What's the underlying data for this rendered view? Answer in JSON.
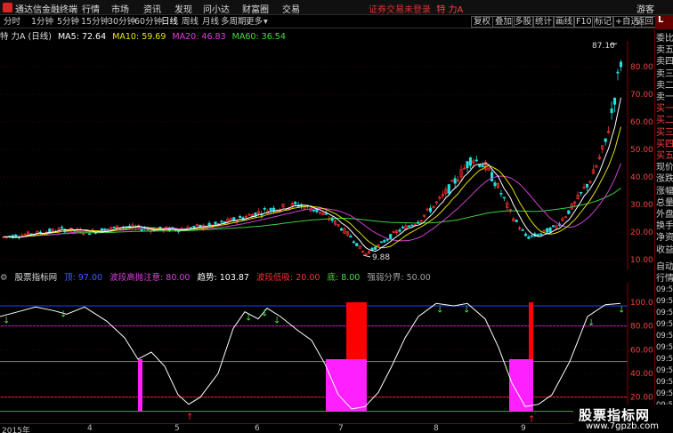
{
  "app": {
    "title": "通达信金融终端",
    "menu": [
      "行情",
      "市场",
      "资讯",
      "发现",
      "问小达",
      "财富圈",
      "交易"
    ],
    "warning": "证券交易未登录",
    "stock_name": "特 力A",
    "guest": "游客",
    "window_buttons": [
      "□",
      "⊟",
      "✕"
    ]
  },
  "toolbar": {
    "periods": [
      "分时",
      "1分钟",
      "5分钟",
      "15分钟",
      "30分钟",
      "60分钟",
      "日线",
      "周线",
      "月线",
      "多周期",
      "更多"
    ],
    "active_period": "日线",
    "right_buttons": [
      "复权",
      "叠加",
      "多股",
      "统计",
      "画线",
      "F10",
      "标记",
      "+自选",
      "返回"
    ]
  },
  "main_chart": {
    "title": "特 力A (日线)",
    "ma": [
      {
        "label": "MA5: 72.64",
        "color": "#ffffff"
      },
      {
        "label": "MA10: 59.69",
        "color": "#e8e800"
      },
      {
        "label": "MA20: 46.83",
        "color": "#e040e0"
      },
      {
        "label": "MA60: 36.54",
        "color": "#40e040"
      }
    ],
    "high_label": "87.10",
    "low_label": "9.88",
    "y_ticks": [
      "80.00",
      "70.00",
      "60.00",
      "50.00",
      "40.00",
      "30.00",
      "20.00",
      "10.00"
    ],
    "y_values": [
      80,
      70,
      60,
      50,
      40,
      30,
      20,
      10
    ],
    "corner": "L"
  },
  "sub_chart": {
    "title": "股票指标网",
    "params": [
      {
        "label": "顶: 97.00",
        "color": "#4060ff"
      },
      {
        "label": "波段高抛注意: 80.00",
        "color": "#e040e0"
      },
      {
        "label": "趋势: 103.87",
        "color": "#ffffff"
      },
      {
        "label": "波段低吸: 20.00",
        "color": "#ff3030"
      },
      {
        "label": "底: 8.00",
        "color": "#40e040"
      },
      {
        "label": "强弱分界: 50.00",
        "color": "#a0a0a0"
      }
    ],
    "y_ticks": [
      "100.0",
      "80.00",
      "60.00",
      "40.00",
      "20.00"
    ],
    "y_values": [
      100,
      80,
      60,
      40,
      20
    ]
  },
  "x_axis": {
    "labels": [
      "2015年",
      "4",
      "5",
      "6",
      "7",
      "8",
      "9"
    ]
  },
  "right_panel": {
    "labels": [
      "委比",
      "卖五",
      "卖四",
      "卖三",
      "卖二",
      "卖一",
      "买一",
      "买二",
      "买三",
      "买四",
      "买五",
      "现价",
      "涨跌",
      "涨幅",
      "总量",
      "外盘",
      "换手",
      "净资",
      "收益"
    ],
    "labels2": [
      "自动",
      "行情",
      "09:51",
      "09:51",
      "09:52",
      "09:52",
      "09:52",
      "09:52",
      "09:52",
      "09:53",
      "09:53",
      "09:53",
      "09:54"
    ],
    "top_mark": "L"
  },
  "watermark": {
    "title": "股票指标网",
    "url": "www.7gpzb.com"
  },
  "colors": {
    "up": "#ff3030",
    "down": "#20e0e0",
    "magenta": "#ff20ff",
    "red_bar": "#ff0000"
  }
}
